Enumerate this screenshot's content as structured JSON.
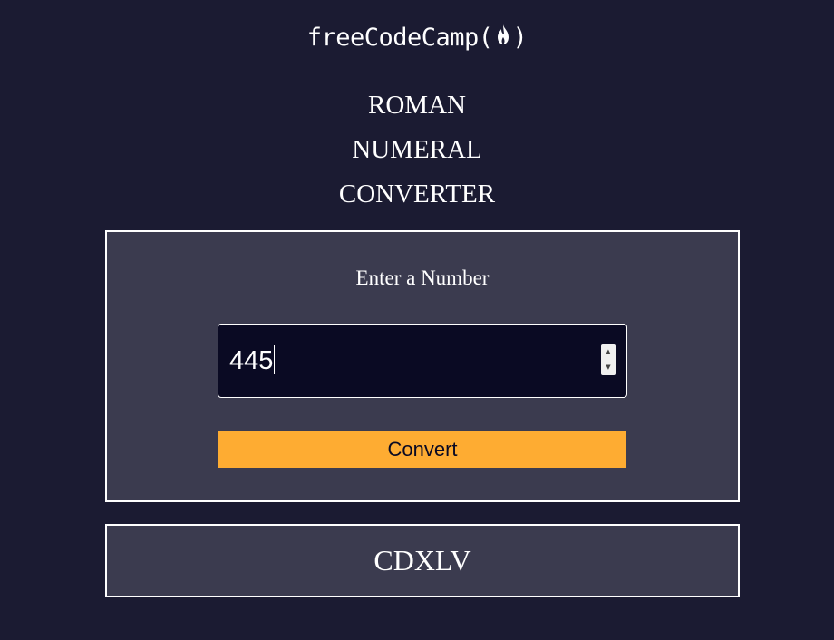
{
  "header": {
    "logo_prefix": "freeCodeCamp(",
    "logo_suffix": ")",
    "logo_icon": "flame-icon"
  },
  "title": {
    "line1": "ROMAN",
    "line2": "NUMERAL",
    "line3": "CONVERTER"
  },
  "form": {
    "label": "Enter a Number",
    "input_value": "445",
    "spin_up": "▲",
    "spin_down": "▼",
    "button_label": "Convert"
  },
  "output": {
    "result": "CDXLV"
  },
  "colors": {
    "background": "#1b1b32",
    "panel": "#3b3b4f",
    "input_bg": "#0a0a23",
    "button": "#feac32"
  }
}
